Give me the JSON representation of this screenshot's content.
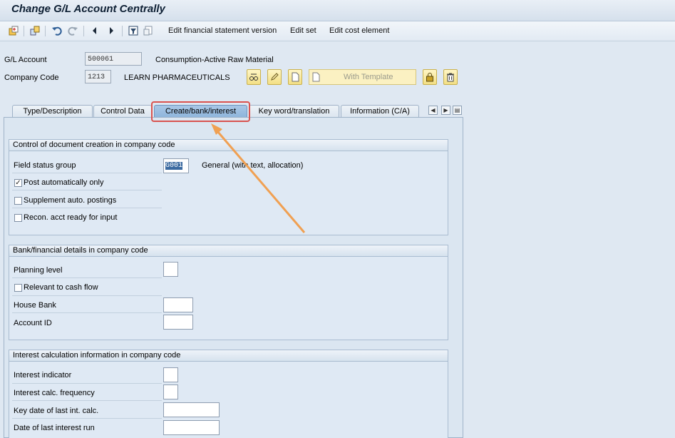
{
  "title": "Change G/L Account Centrally",
  "toolbar": {
    "icons": [
      "page-icon",
      "copy-icon",
      "undo-icon",
      "redo-icon",
      "prev-icon",
      "next-icon",
      "filter-icon",
      "clear-icon"
    ],
    "links": [
      "Edit financial statement version",
      "Edit set",
      "Edit cost element"
    ]
  },
  "header": {
    "gl_account_label": "G/L Account",
    "gl_account_value": "500061",
    "gl_account_desc": "Consumption-Active Raw Material",
    "company_code_label": "Company Code",
    "company_code_value": "1213",
    "company_name": "LEARN PHARMACEUTICALS",
    "with_template_label": "With Template"
  },
  "tabs": [
    "Type/Description",
    "Control Data",
    "Create/bank/interest",
    "Key word/translation",
    "Information (C/A)"
  ],
  "active_tab": "Create/bank/interest",
  "groups": {
    "doc_creation": {
      "title": "Control of document creation in company code",
      "field_status_group_label": "Field status group",
      "field_status_group_value": "G001",
      "field_status_group_desc": "General (with text, allocation)",
      "post_auto_label": "Post automatically only",
      "post_auto_checked": "✓",
      "supplement_label": "Supplement auto. postings",
      "recon_label": "Recon. acct ready for input"
    },
    "bank": {
      "title": "Bank/financial details in company code",
      "planning_level_label": "Planning level",
      "cash_flow_label": "Relevant to cash flow",
      "house_bank_label": "House Bank",
      "account_id_label": "Account ID"
    },
    "interest": {
      "title": "Interest calculation information in company code",
      "indicator_label": "Interest indicator",
      "frequency_label": "Interest calc. frequency",
      "key_date_label": "Key date of last int. calc.",
      "last_run_label": "Date of last interest run"
    }
  },
  "colors": {
    "highlight": "#d9534f",
    "arrow": "#f0a052",
    "active_tab": "#9dbde0"
  }
}
